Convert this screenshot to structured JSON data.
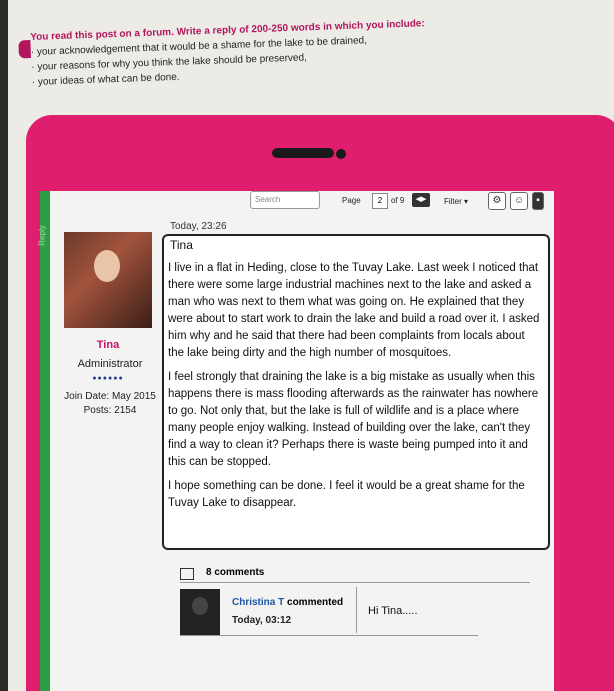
{
  "task": {
    "heading": "You read this post on a forum. Write a reply of 200-250 words in which you include:",
    "points": [
      "your acknowledgement that it would be a shame for the lake to be drained,",
      "your reasons for why you think the lake should be preserved,",
      "your ideas of what can be done."
    ]
  },
  "strip_label": "Reply",
  "toolbar": {
    "search_placeholder": "Search",
    "page_label": "Page",
    "page_number": "2",
    "page_of": "of 9",
    "filter_label": "Filter"
  },
  "post": {
    "date": "Today, 23:26",
    "title": "Tina",
    "paragraphs": [
      "I live in a flat in Heding, close to the Tuvay Lake. Last week I noticed that there were some large industrial machines next to the lake and asked a man who was next to them what was going on. He explained that they were about to start work to drain the lake and build a road over it. I asked him why and he said that there had been complaints from locals about the lake being dirty and the high number of mosquitoes.",
      "I feel strongly that draining the lake is a big mistake as usually when this happens there is mass flooding afterwards as the rainwater has nowhere to go. Not only that, but the lake is full of wildlife and is a place where many people enjoy walking. Instead of building over the lake, can't they find a way to clean it? Perhaps there is waste being pumped into it and this can be stopped.",
      "I hope something can be done. I feel it would be a great shame for the Tuvay Lake to disappear."
    ]
  },
  "user": {
    "name": "Tina",
    "role": "Administrator",
    "rank_dots": "●●●●●●",
    "join_date": "Join Date: May 2015",
    "posts": "Posts: 2154"
  },
  "comments": {
    "count_label": "8 comments",
    "items": [
      {
        "author": "Christina T",
        "action": " commented",
        "time": "Today, 03:12",
        "text": "Hi Tina....."
      }
    ]
  }
}
